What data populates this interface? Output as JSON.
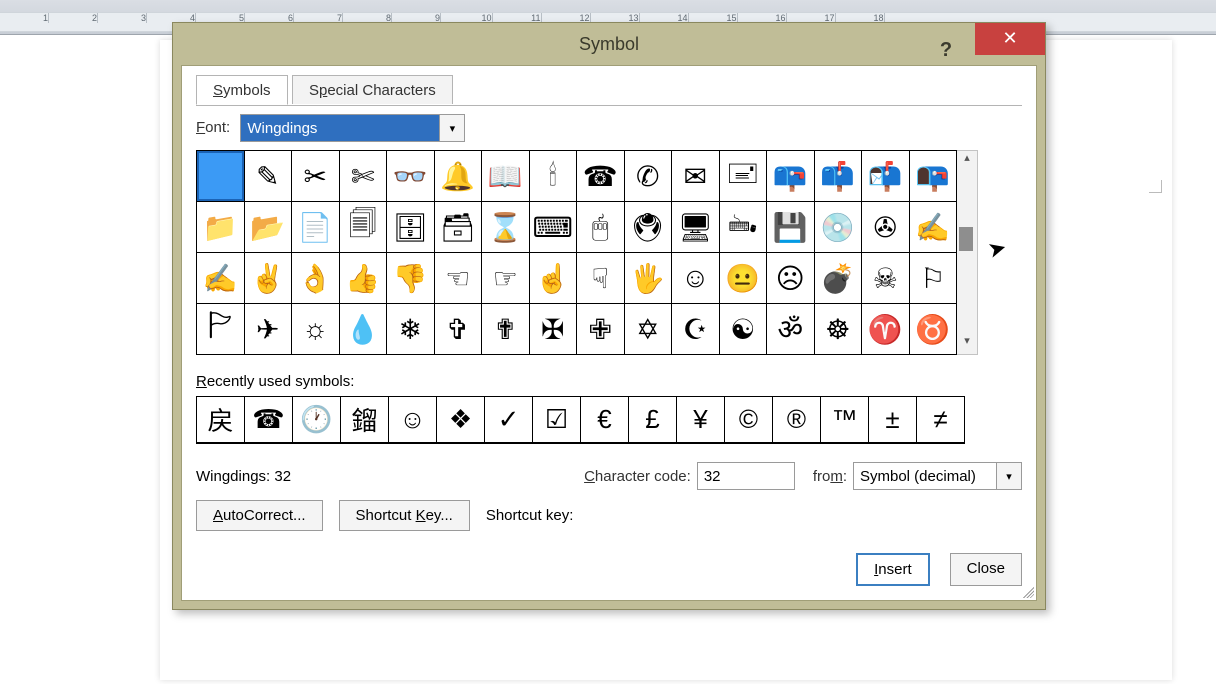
{
  "dialog": {
    "title": "Symbol",
    "help": "?",
    "close": "✕"
  },
  "tabs": {
    "symbols": {
      "accel": "S",
      "rest": "ymbols"
    },
    "special": {
      "pre": "S",
      "accel": "p",
      "rest": "ecial Characters"
    }
  },
  "font": {
    "label_accel": "F",
    "label_rest": "ont:",
    "value": "Wingdings"
  },
  "grid": [
    [
      " ",
      "✎",
      "✂",
      "✄",
      "👓",
      "🔔",
      "📖",
      "🕯",
      "☎",
      "✆",
      "✉",
      "🖃",
      "📪",
      "📫",
      "📬",
      "📭"
    ],
    [
      "📁",
      "📂",
      "📄",
      "🗐",
      "🗄",
      "🗃",
      "⌛",
      "⌨",
      "🖱",
      "🖲",
      "🖥",
      "🖦",
      "💾",
      "💿",
      "✇",
      "✍"
    ],
    [
      "✍",
      "✌",
      "👌",
      "👍",
      "👎",
      "☜",
      "☞",
      "☝",
      "☟",
      "🖐",
      "☺",
      "😐",
      "☹",
      "💣",
      "☠",
      "⚐"
    ],
    [
      "🏱",
      "✈",
      "☼",
      "💧",
      "❄",
      "✞",
      "✟",
      "✠",
      "✙",
      "✡",
      "☪",
      "☯",
      "ॐ",
      "☸",
      "♈",
      "♉"
    ]
  ],
  "recent_label_accel": "R",
  "recent_label_rest": "ecently used symbols:",
  "recent": [
    "戻",
    "☎",
    "🕐",
    "鎦",
    "☺",
    "❖",
    "✓",
    "☑",
    "€",
    "£",
    "¥",
    "©",
    "®",
    "™",
    "±",
    "≠"
  ],
  "selected_desc": "Wingdings: 32",
  "char_code": {
    "label_accel": "C",
    "label_rest": "haracter code:",
    "value": "32"
  },
  "from": {
    "label_pre": "fro",
    "label_accel": "m",
    "label_rest": ":",
    "value": "Symbol (decimal)"
  },
  "buttons": {
    "autocorrect": {
      "accel": "A",
      "rest": "utoCorrect..."
    },
    "shortcut": {
      "pre": "Shortcut ",
      "accel": "K",
      "rest": "ey..."
    },
    "shortcut_label": "Shortcut key:",
    "insert": {
      "accel": "I",
      "rest": "nsert"
    },
    "close": "Close"
  }
}
